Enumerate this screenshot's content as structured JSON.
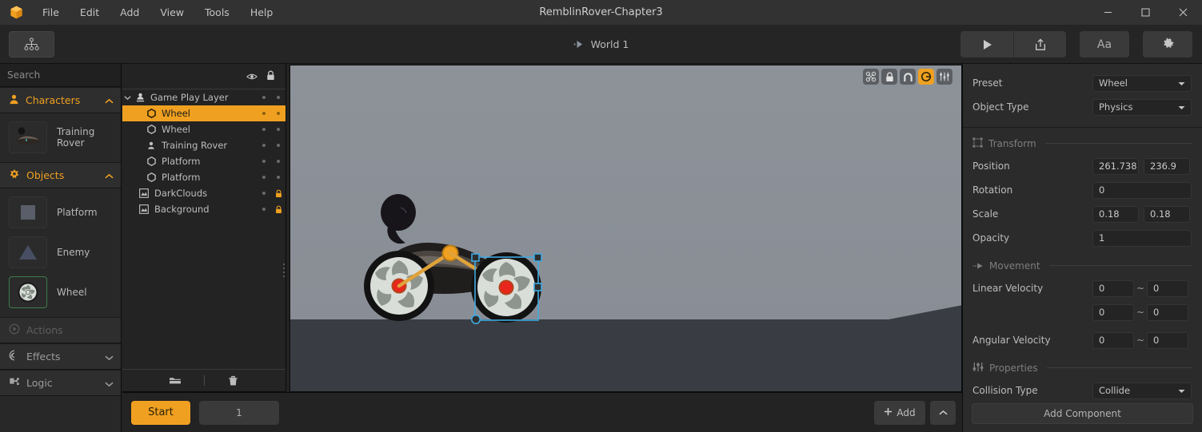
{
  "window": {
    "title": "RemblinRover-Chapter3",
    "logo_icon": "orange-box-logo",
    "minimize_icon": "minimize-icon",
    "maximize_icon": "maximize-icon",
    "close_icon": "close-icon"
  },
  "menu": [
    {
      "label": "File"
    },
    {
      "label": "Edit"
    },
    {
      "label": "Add"
    },
    {
      "label": "View"
    },
    {
      "label": "Tools"
    },
    {
      "label": "Help"
    }
  ],
  "toolbar": {
    "hierarchy_tool_icon": "sitemap-icon",
    "world_label": "World 1",
    "world_play_icon": "play-small-icon",
    "play_icon": "play-icon",
    "export_icon": "share-export-icon",
    "text_label": "Aa",
    "settings_icon": "gear-icon"
  },
  "sidebar": {
    "search": {
      "placeholder": "Search",
      "value": "",
      "icon": "search-icon"
    },
    "sections": [
      {
        "label": "Characters",
        "icon": "person-icon",
        "chevron": "chevron-up-icon",
        "expanded": true,
        "items": [
          {
            "label": "Training Rover",
            "thumb": "rover-thumb",
            "selected": false
          }
        ]
      },
      {
        "label": "Objects",
        "icon": "flower-icon",
        "chevron": "chevron-up-icon",
        "expanded": true,
        "items": [
          {
            "label": "Platform",
            "thumb": "square-thumb",
            "selected": false
          },
          {
            "label": "Enemy",
            "thumb": "triangle-thumb",
            "selected": false
          },
          {
            "label": "Wheel",
            "thumb": "wheel-thumb",
            "selected": true
          }
        ]
      },
      {
        "label": "Actions",
        "icon": "play-circle-icon",
        "chevron": "",
        "expanded": false,
        "disabled": true,
        "items": []
      },
      {
        "label": "Effects",
        "icon": "spiral-icon",
        "chevron": "chevron-down-icon",
        "expanded": false,
        "items": []
      },
      {
        "label": "Logic",
        "icon": "logic-puzzle-icon",
        "chevron": "chevron-down-icon",
        "expanded": false,
        "items": []
      }
    ]
  },
  "hierarchy": {
    "header": {
      "visibility_icon": "eye-icon",
      "lock_icon": "lock-icon"
    },
    "rows": [
      {
        "name": "Game Play Layer",
        "icon": "layer-person-icon",
        "indent": 0,
        "arrow": "chevron-down-icon",
        "selected": false,
        "visible_dot": true,
        "lock_state": "unlocked"
      },
      {
        "name": "Wheel",
        "icon": "hexagon-icon",
        "indent": 1,
        "arrow": "",
        "selected": true,
        "visible_dot": true,
        "lock_state": "unlocked"
      },
      {
        "name": "Wheel",
        "icon": "hexagon-icon",
        "indent": 1,
        "arrow": "",
        "selected": false,
        "visible_dot": true,
        "lock_state": "unlocked"
      },
      {
        "name": "Training Rover",
        "icon": "person-icon",
        "indent": 1,
        "arrow": "",
        "selected": false,
        "visible_dot": true,
        "lock_state": "unlocked"
      },
      {
        "name": "Platform",
        "icon": "hexagon-icon",
        "indent": 1,
        "arrow": "",
        "selected": false,
        "visible_dot": true,
        "lock_state": "unlocked"
      },
      {
        "name": "Platform",
        "icon": "hexagon-icon",
        "indent": 1,
        "arrow": "",
        "selected": false,
        "visible_dot": true,
        "lock_state": "unlocked"
      },
      {
        "name": "DarkClouds",
        "icon": "image-icon",
        "indent": 0.5,
        "arrow": "",
        "selected": false,
        "visible_dot": true,
        "lock_state": "locked"
      },
      {
        "name": "Background",
        "icon": "image-icon",
        "indent": 0.5,
        "arrow": "",
        "selected": false,
        "visible_dot": true,
        "lock_state": "locked"
      }
    ],
    "footer": {
      "folder_icon": "folder-icon",
      "delete_icon": "trash-icon"
    }
  },
  "viewport": {
    "tools": [
      {
        "name": "nodes-icon",
        "active": false
      },
      {
        "name": "lock-icon",
        "active": false
      },
      {
        "name": "magnet-icon",
        "active": false
      },
      {
        "name": "link-icon",
        "active": true
      },
      {
        "name": "skeleton-icon",
        "active": false
      }
    ],
    "scene": {
      "sky_color": "#8d9299",
      "ground_color": "#393d43",
      "selection_color": "#3fa9e0",
      "joint_color": "#f0a020",
      "pivot_color": "#e8261c"
    }
  },
  "inspector": {
    "preset": {
      "label": "Preset",
      "value": "Wheel",
      "caret": "chevron-down-icon"
    },
    "object_type": {
      "label": "Object Type",
      "value": "Physics",
      "caret": "chevron-down-icon"
    },
    "transform": {
      "title": "Transform",
      "icon": "transform-icon",
      "position": {
        "label": "Position",
        "x": "261.738",
        "y": "236.9"
      },
      "rotation": {
        "label": "Rotation",
        "value": "0"
      },
      "scale": {
        "label": "Scale",
        "x": "0.18",
        "y": "0.18"
      },
      "opacity": {
        "label": "Opacity",
        "value": "1"
      }
    },
    "movement": {
      "title": "Movement",
      "icon": "movement-arrow-icon",
      "linear_velocity": {
        "label": "Linear Velocity",
        "row1_min": "0",
        "row1_max": "0",
        "row2_min": "0",
        "row2_max": "0",
        "sep": "~"
      },
      "angular_velocity": {
        "label": "Angular Velocity",
        "min": "0",
        "max": "0",
        "sep": "~"
      }
    },
    "properties": {
      "title": "Properties",
      "icon": "sliders-icon",
      "collision_type": {
        "label": "Collision Type",
        "value": "Collide",
        "caret": "chevron-down-icon"
      }
    },
    "add_component": {
      "label": "Add Component"
    }
  },
  "bottombar": {
    "start_label": "Start",
    "frame_value": "1",
    "add_label": "Add",
    "add_icon": "plus-icon",
    "collapse_icon": "chevron-up-icon"
  },
  "colors": {
    "accent": "#f0a020",
    "panel_bg": "#282828",
    "panel_dark": "#232323",
    "titlebar": "#323232",
    "selection_blue": "#3fa9e0",
    "lock_orange": "#f0a020"
  }
}
